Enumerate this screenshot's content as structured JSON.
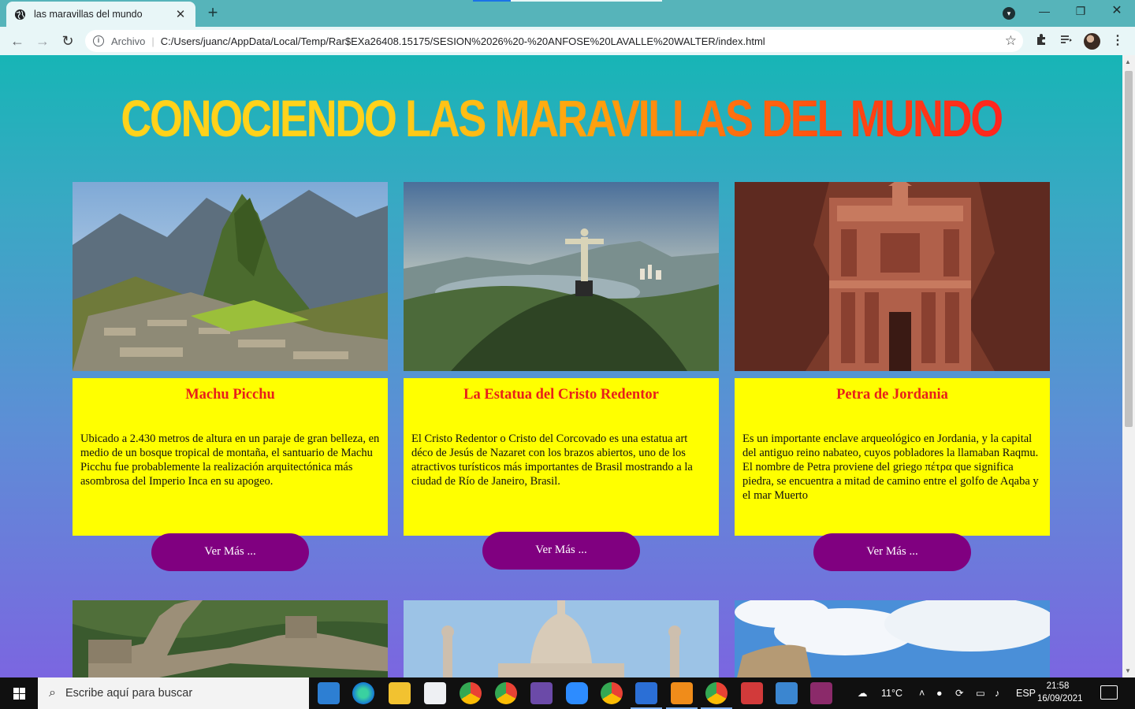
{
  "browser": {
    "tab_title": "las maravillas del mundo",
    "tab_close": "✕",
    "new_tab": "+",
    "scheme_label": "Archivo",
    "separator": "|",
    "url": "C:/Users/juanc/AppData/Local/Temp/Rar$EXa26408.15175/SESION%2026%20-%20ANFOSE%20LAVALLE%20WALTER/index.html",
    "icons": [
      "globe-icon",
      "back-icon",
      "forward-icon",
      "reload-icon",
      "info-icon",
      "star-icon",
      "extensions-icon",
      "reading-list-icon",
      "profile-avatar",
      "menu-icon"
    ]
  },
  "page": {
    "title": "CONOCIENDO LAS MARAVILLAS DEL MUNDO",
    "cards": [
      {
        "title": "Machu Picchu",
        "text": "Ubicado a 2.430 metros de altura en un paraje de gran belleza, en medio de un bosque tropical de montaña, el santuario de Machu Picchu fue probablemente la realización arquitectónica más asombrosa del Imperio Inca en su apogeo.",
        "button": "Ver Más ..."
      },
      {
        "title": "La Estatua del Cristo Redentor",
        "text": "El Cristo Redentor o Cristo del Corcovado es una estatua art déco de Jesús de Nazaret con los brazos abiertos, uno de los atractivos turísticos más importantes de Brasil mostrando a la ciudad de Río de Janeiro, Brasil.",
        "button": "Ver Más ..."
      },
      {
        "title": "Petra de Jordania",
        "text": "Es un importante enclave arqueológico en Jordania, y la capital del antiguo reino nabateo, cuyos pobladores la llamaban Raqmu. El nombre de Petra proviene del griego πέτρα que significa piedra, se encuentra a mitad de camino entre el golfo de Aqaba y el mar Muerto",
        "button": "Ver Más ..."
      }
    ]
  },
  "taskbar": {
    "search_placeholder": "Escribe aquí para buscar",
    "weather": "11°C",
    "language": "ESP",
    "time": "21:58",
    "date": "16/09/2021"
  }
}
